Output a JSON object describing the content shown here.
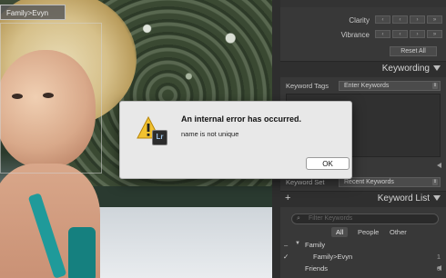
{
  "photo": {
    "face_tag": "Family>Evyn"
  },
  "develop": {
    "clarity_label": "Clarity",
    "vibrance_label": "Vibrance",
    "reset_all": "Reset All"
  },
  "keywording": {
    "title": "Keywording",
    "keyword_tags_label": "Keyword Tags",
    "keyword_tags_value": "Enter Keywords",
    "keyword_set_label": "Keyword Set",
    "keyword_set_value": "Recent Keywords"
  },
  "keyword_list": {
    "title": "Keyword List",
    "add_symbol": "+",
    "search_placeholder": "Filter Keywords",
    "tabs": [
      "All",
      "People",
      "Other"
    ],
    "items": [
      {
        "name": "Family",
        "count": ""
      },
      {
        "name": "Family>Evyn",
        "count": "1"
      },
      {
        "name": "Friends",
        "count": "0"
      }
    ]
  },
  "dialog": {
    "title": "An internal error has occurred.",
    "message": "name is not unique",
    "ok_label": "OK",
    "badge": "Lr"
  }
}
